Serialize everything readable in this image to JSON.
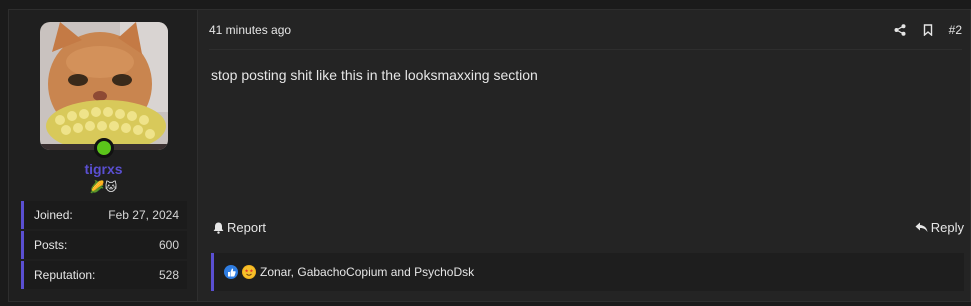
{
  "user": {
    "name": "tigrxs",
    "badges": "🌽🐱",
    "stats": [
      {
        "label": "Joined:",
        "value": "Feb 27, 2024"
      },
      {
        "label": "Posts:",
        "value": "600"
      },
      {
        "label": "Reputation:",
        "value": "528"
      }
    ],
    "online_color": "#5bc41a",
    "accent": "#5a4fd1"
  },
  "post": {
    "time": "41 minutes ago",
    "number": "#2",
    "body": "stop posting shit like this in the looksmaxxing section",
    "report_label": "Report",
    "reply_label": "Reply"
  },
  "reactions": {
    "icons": [
      "thumbs-up-icon",
      "star-eyes-icon"
    ],
    "names": "Zonar, GabachoCopium and PsychoDsk"
  }
}
